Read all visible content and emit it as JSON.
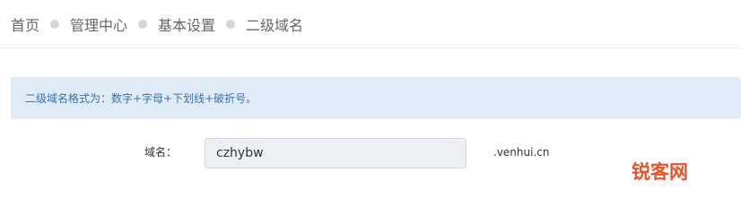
{
  "breadcrumb": {
    "items": [
      {
        "label": "首页"
      },
      {
        "label": "管理中心"
      },
      {
        "label": "基本设置"
      },
      {
        "label": "二级域名"
      }
    ]
  },
  "alert": {
    "text": "二级域名格式为：数字+字母+下划线+破折号。"
  },
  "form": {
    "domain_label": "域名：",
    "domain_value": "czhybw",
    "domain_suffix": ".venhui.cn"
  },
  "watermark": {
    "text": "锐客网"
  },
  "colors": {
    "alert_bg": "#dfebf6",
    "alert_text": "#3b74a8",
    "input_bg": "#eceff3",
    "watermark": "#e8542a"
  }
}
